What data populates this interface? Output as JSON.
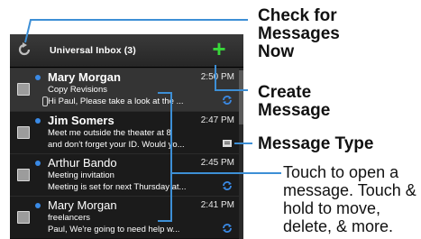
{
  "header": {
    "title": "Universal Inbox (3)",
    "refresh_icon": "refresh-icon",
    "compose_icon": "plus-icon",
    "compose_symbol": "+"
  },
  "messages": [
    {
      "sender": "Mary Morgan",
      "time": "2:50 PM",
      "subject": "Copy Revisions",
      "preview": "Hi Paul, Please take a look at the ...",
      "unread": true,
      "selected": true,
      "icon": "sync-icon",
      "attachment": true
    },
    {
      "sender": "Jim Somers",
      "time": "2:47 PM",
      "subject": "Meet me outside the theater at 8",
      "preview": "and don't forget your ID. Would yo...",
      "unread": true,
      "selected": false,
      "icon": "message-type-icon",
      "attachment": false
    },
    {
      "sender": "Arthur Bando",
      "time": "2:45 PM",
      "subject": "Meeting invitation",
      "preview": "Meeting is set for next Thursday at...",
      "unread": true,
      "selected": false,
      "icon": "sync-icon",
      "attachment": false
    },
    {
      "sender": "Mary Morgan",
      "time": "2:41 PM",
      "subject": "freelancers",
      "preview": "Paul, We're going to need help w...",
      "unread": true,
      "selected": false,
      "icon": "sync-icon",
      "attachment": false
    }
  ],
  "callouts": {
    "check_messages": [
      "Check for",
      "Messages",
      "Now"
    ],
    "create_message": [
      "Create",
      "Message"
    ],
    "message_type": "Message Type",
    "touch_help": [
      "Touch to open a",
      "message. Touch &",
      "hold to move,",
      "delete, & more."
    ]
  },
  "colors": {
    "background": "#111111",
    "accent_green": "#38d83a",
    "unread_dot": "#3a8ae6",
    "callout_line": "#3d8fd6"
  }
}
